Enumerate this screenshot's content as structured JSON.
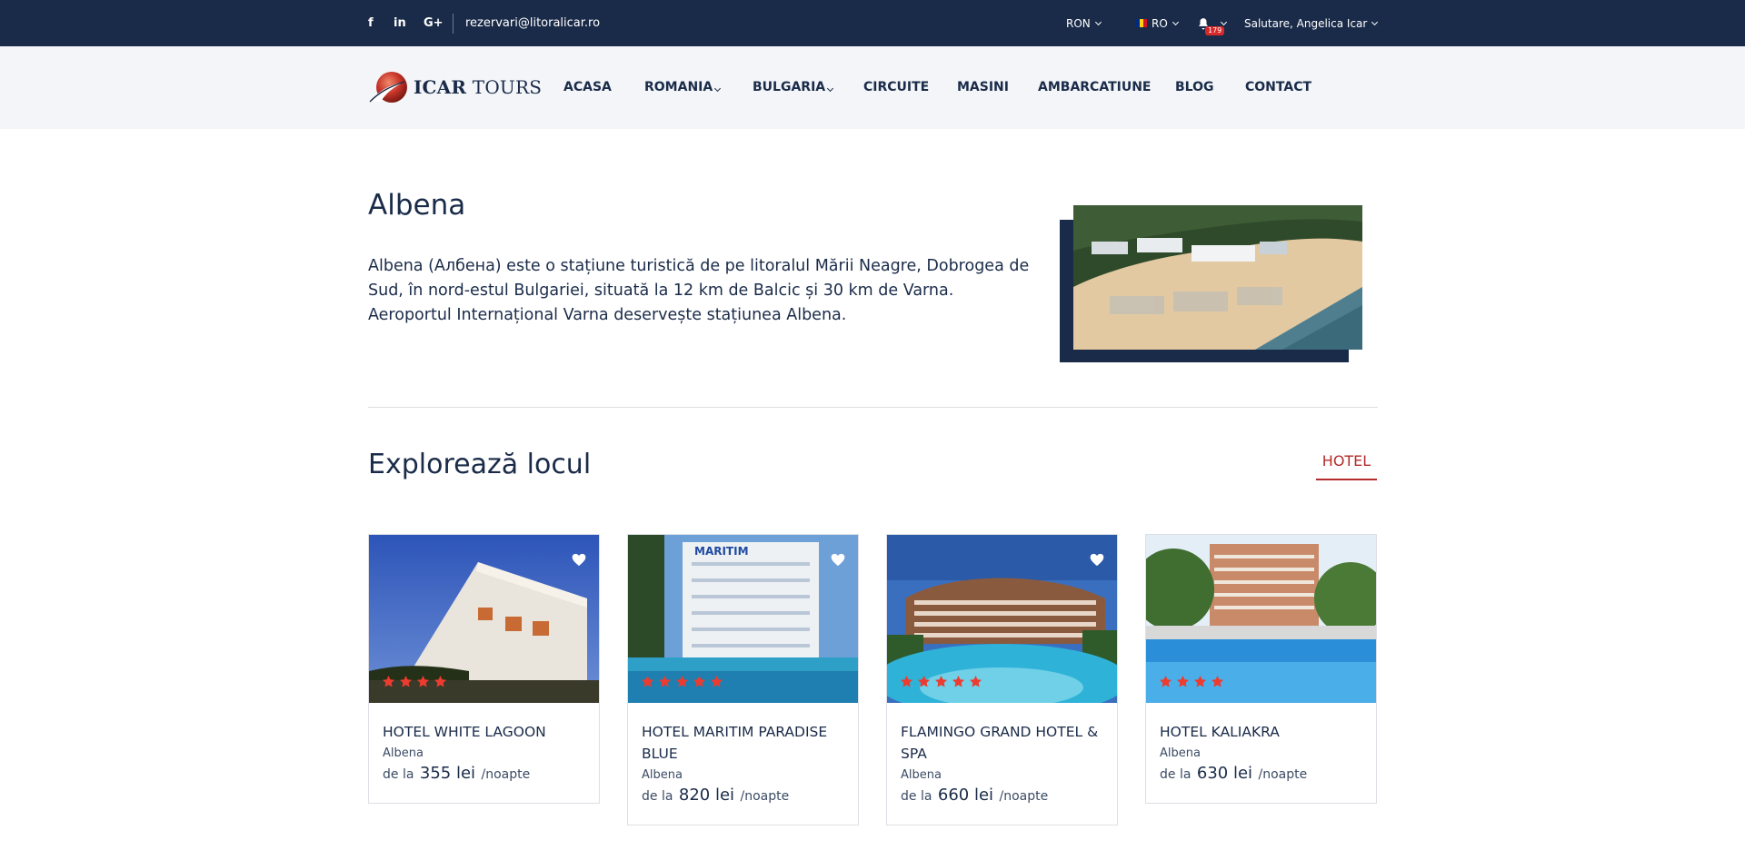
{
  "topbar": {
    "social": [
      "f",
      "in",
      "G+"
    ],
    "email": "rezervari@litoralicar.ro",
    "currency": "RON",
    "language": "RO",
    "notifications_count": "179",
    "greeting": "Salutare, Angelica Icar"
  },
  "logo": {
    "bold": "ICAR",
    "rest": " TOURS"
  },
  "nav": [
    "ACASA",
    "ROMANIA",
    "BULGARIA",
    "CIRCUITE",
    "MASINI",
    "AMBARCATIUNE",
    "BLOG",
    "CONTACT"
  ],
  "intro": {
    "title": "Albena",
    "description": "Albena (Албена) este o stațiune turistică de pe litoralul Mării Neagre, Dobrogea de Sud, în nord-estul Bulgariei, situată la 12 km de Balcic și 30 km de Varna. Aeroportul Internațional Varna deservește stațiunea Albena."
  },
  "explore": {
    "title": "Explorează locul",
    "tab": "HOTEL"
  },
  "hotels": [
    {
      "name": "HOTEL WHITE LAGOON",
      "location": "Albena",
      "price_prefix": "de la",
      "price": "355 lei",
      "price_suffix": "/noapte",
      "stars": 4,
      "favorite": true
    },
    {
      "name": "HOTEL MARITIM PARADISE BLUE",
      "location": "Albena",
      "price_prefix": "de la",
      "price": "820 lei",
      "price_suffix": "/noapte",
      "stars": 5,
      "favorite": true
    },
    {
      "name": "FLAMINGO GRAND HOTEL & SPA",
      "location": "Albena",
      "price_prefix": "de la",
      "price": "660 lei",
      "price_suffix": "/noapte",
      "stars": 5,
      "favorite": true
    },
    {
      "name": "HOTEL KALIAKRA",
      "location": "Albena",
      "price_prefix": "de la",
      "price": "630 lei",
      "price_suffix": "/noapte",
      "stars": 4,
      "favorite": false
    }
  ],
  "photo_labels": {
    "hotel_2_sign": "MARITIM"
  },
  "colors": {
    "navy": "#1a2b49",
    "accent_red": "#b52a2a",
    "star_red": "#ee3b2f",
    "badge_red": "#d8282a"
  }
}
